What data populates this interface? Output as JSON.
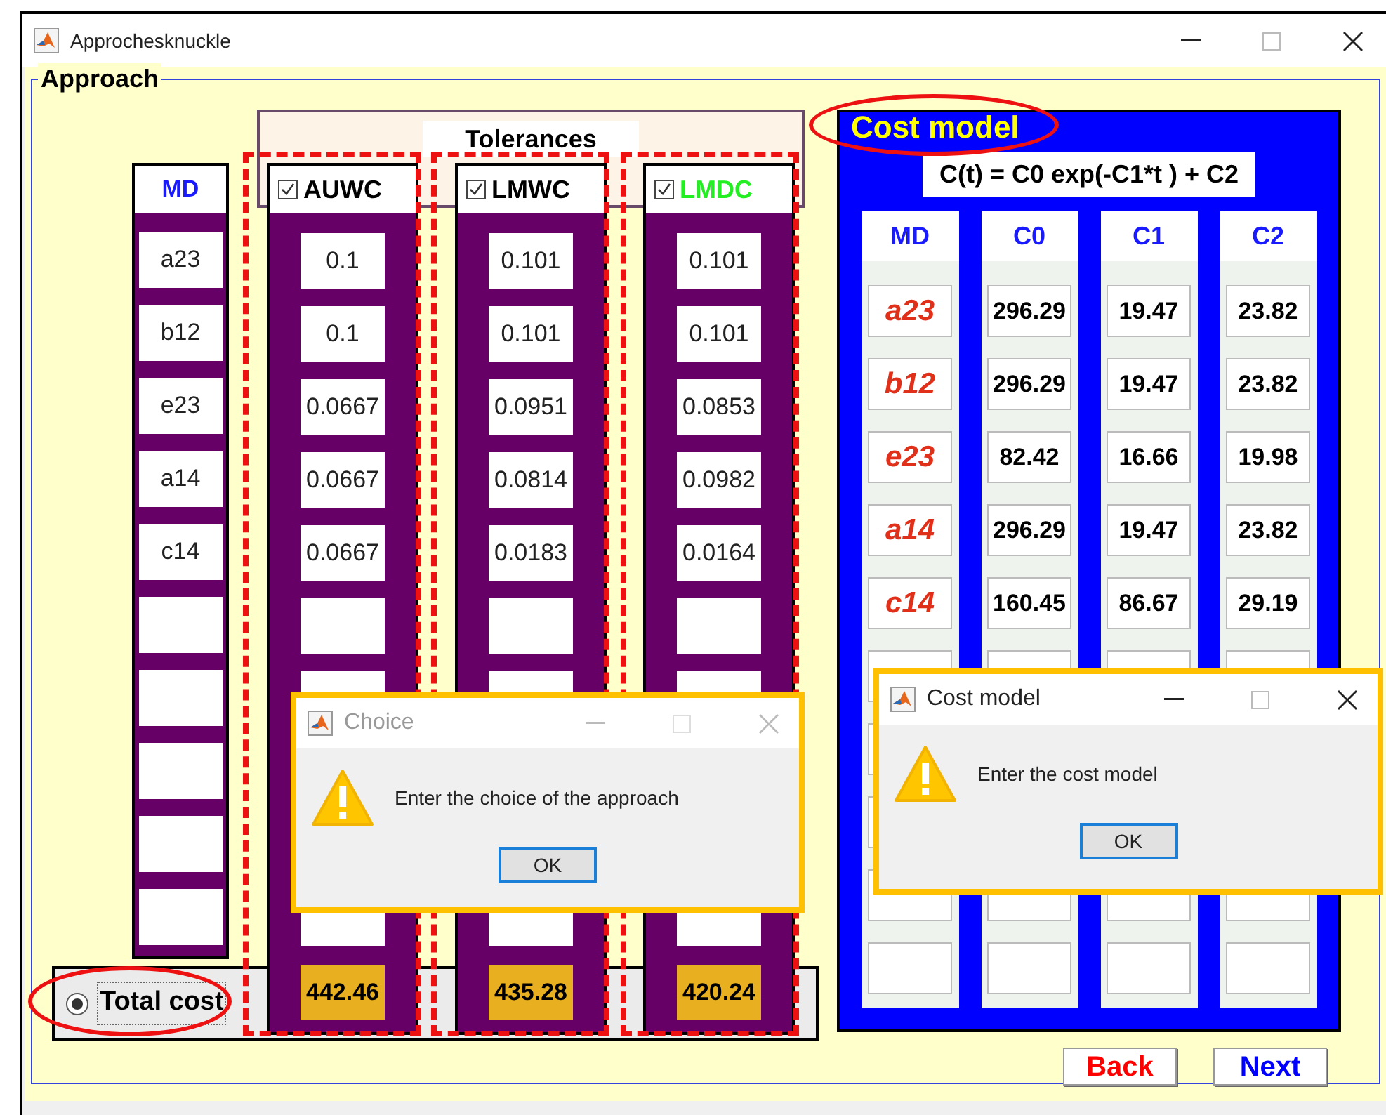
{
  "window": {
    "title": "Approchesknuckle"
  },
  "approach_panel": {
    "title": "Approach",
    "md_column": {
      "header": "MD",
      "cells": [
        "a23",
        "b12",
        "e23",
        "a14",
        "c14"
      ]
    },
    "tolerances": {
      "title": "Tolerances",
      "columns": [
        {
          "label": "AUWC",
          "checked": true,
          "color": "#000000",
          "cells": [
            "0.1",
            "0.1",
            "0.0667",
            "0.0667",
            "0.0667"
          ],
          "total": "442.46"
        },
        {
          "label": "LMWC",
          "checked": true,
          "color": "#000000",
          "cells": [
            "0.101",
            "0.101",
            "0.0951",
            "0.0814",
            "0.0183"
          ],
          "total": "435.28"
        },
        {
          "label": "LMDC",
          "checked": true,
          "color": "#22ee22",
          "cells": [
            "0.101",
            "0.101",
            "0.0853",
            "0.0982",
            "0.0164"
          ],
          "total": "420.24"
        }
      ]
    },
    "total_cost": {
      "label": "Total cost",
      "selected": true
    }
  },
  "cost_model": {
    "title": "Cost model",
    "formula": "C(t) = C0 exp(-C1*t ) + C2",
    "columns": [
      {
        "header": "MD",
        "kind": "name",
        "cells": [
          "a23",
          "b12",
          "e23",
          "a14",
          "c14"
        ]
      },
      {
        "header": "C0",
        "kind": "number",
        "cells": [
          "296.29",
          "296.29",
          "82.42",
          "296.29",
          "160.45"
        ]
      },
      {
        "header": "C1",
        "kind": "number",
        "cells": [
          "19.47",
          "19.47",
          "16.66",
          "19.47",
          "86.67"
        ]
      },
      {
        "header": "C2",
        "kind": "number",
        "cells": [
          "23.82",
          "23.82",
          "19.98",
          "23.82",
          "29.19"
        ]
      }
    ]
  },
  "buttons": [
    {
      "label": "Back",
      "color": "#ff0000"
    },
    {
      "label": "Next",
      "color": "#0000ff"
    }
  ],
  "dialogs": [
    {
      "title": "Choice",
      "active": false,
      "message": "Enter the choice of the approach",
      "button": "OK"
    },
    {
      "title": "Cost model",
      "active": true,
      "message": "Enter the cost model",
      "button": "OK"
    }
  ]
}
